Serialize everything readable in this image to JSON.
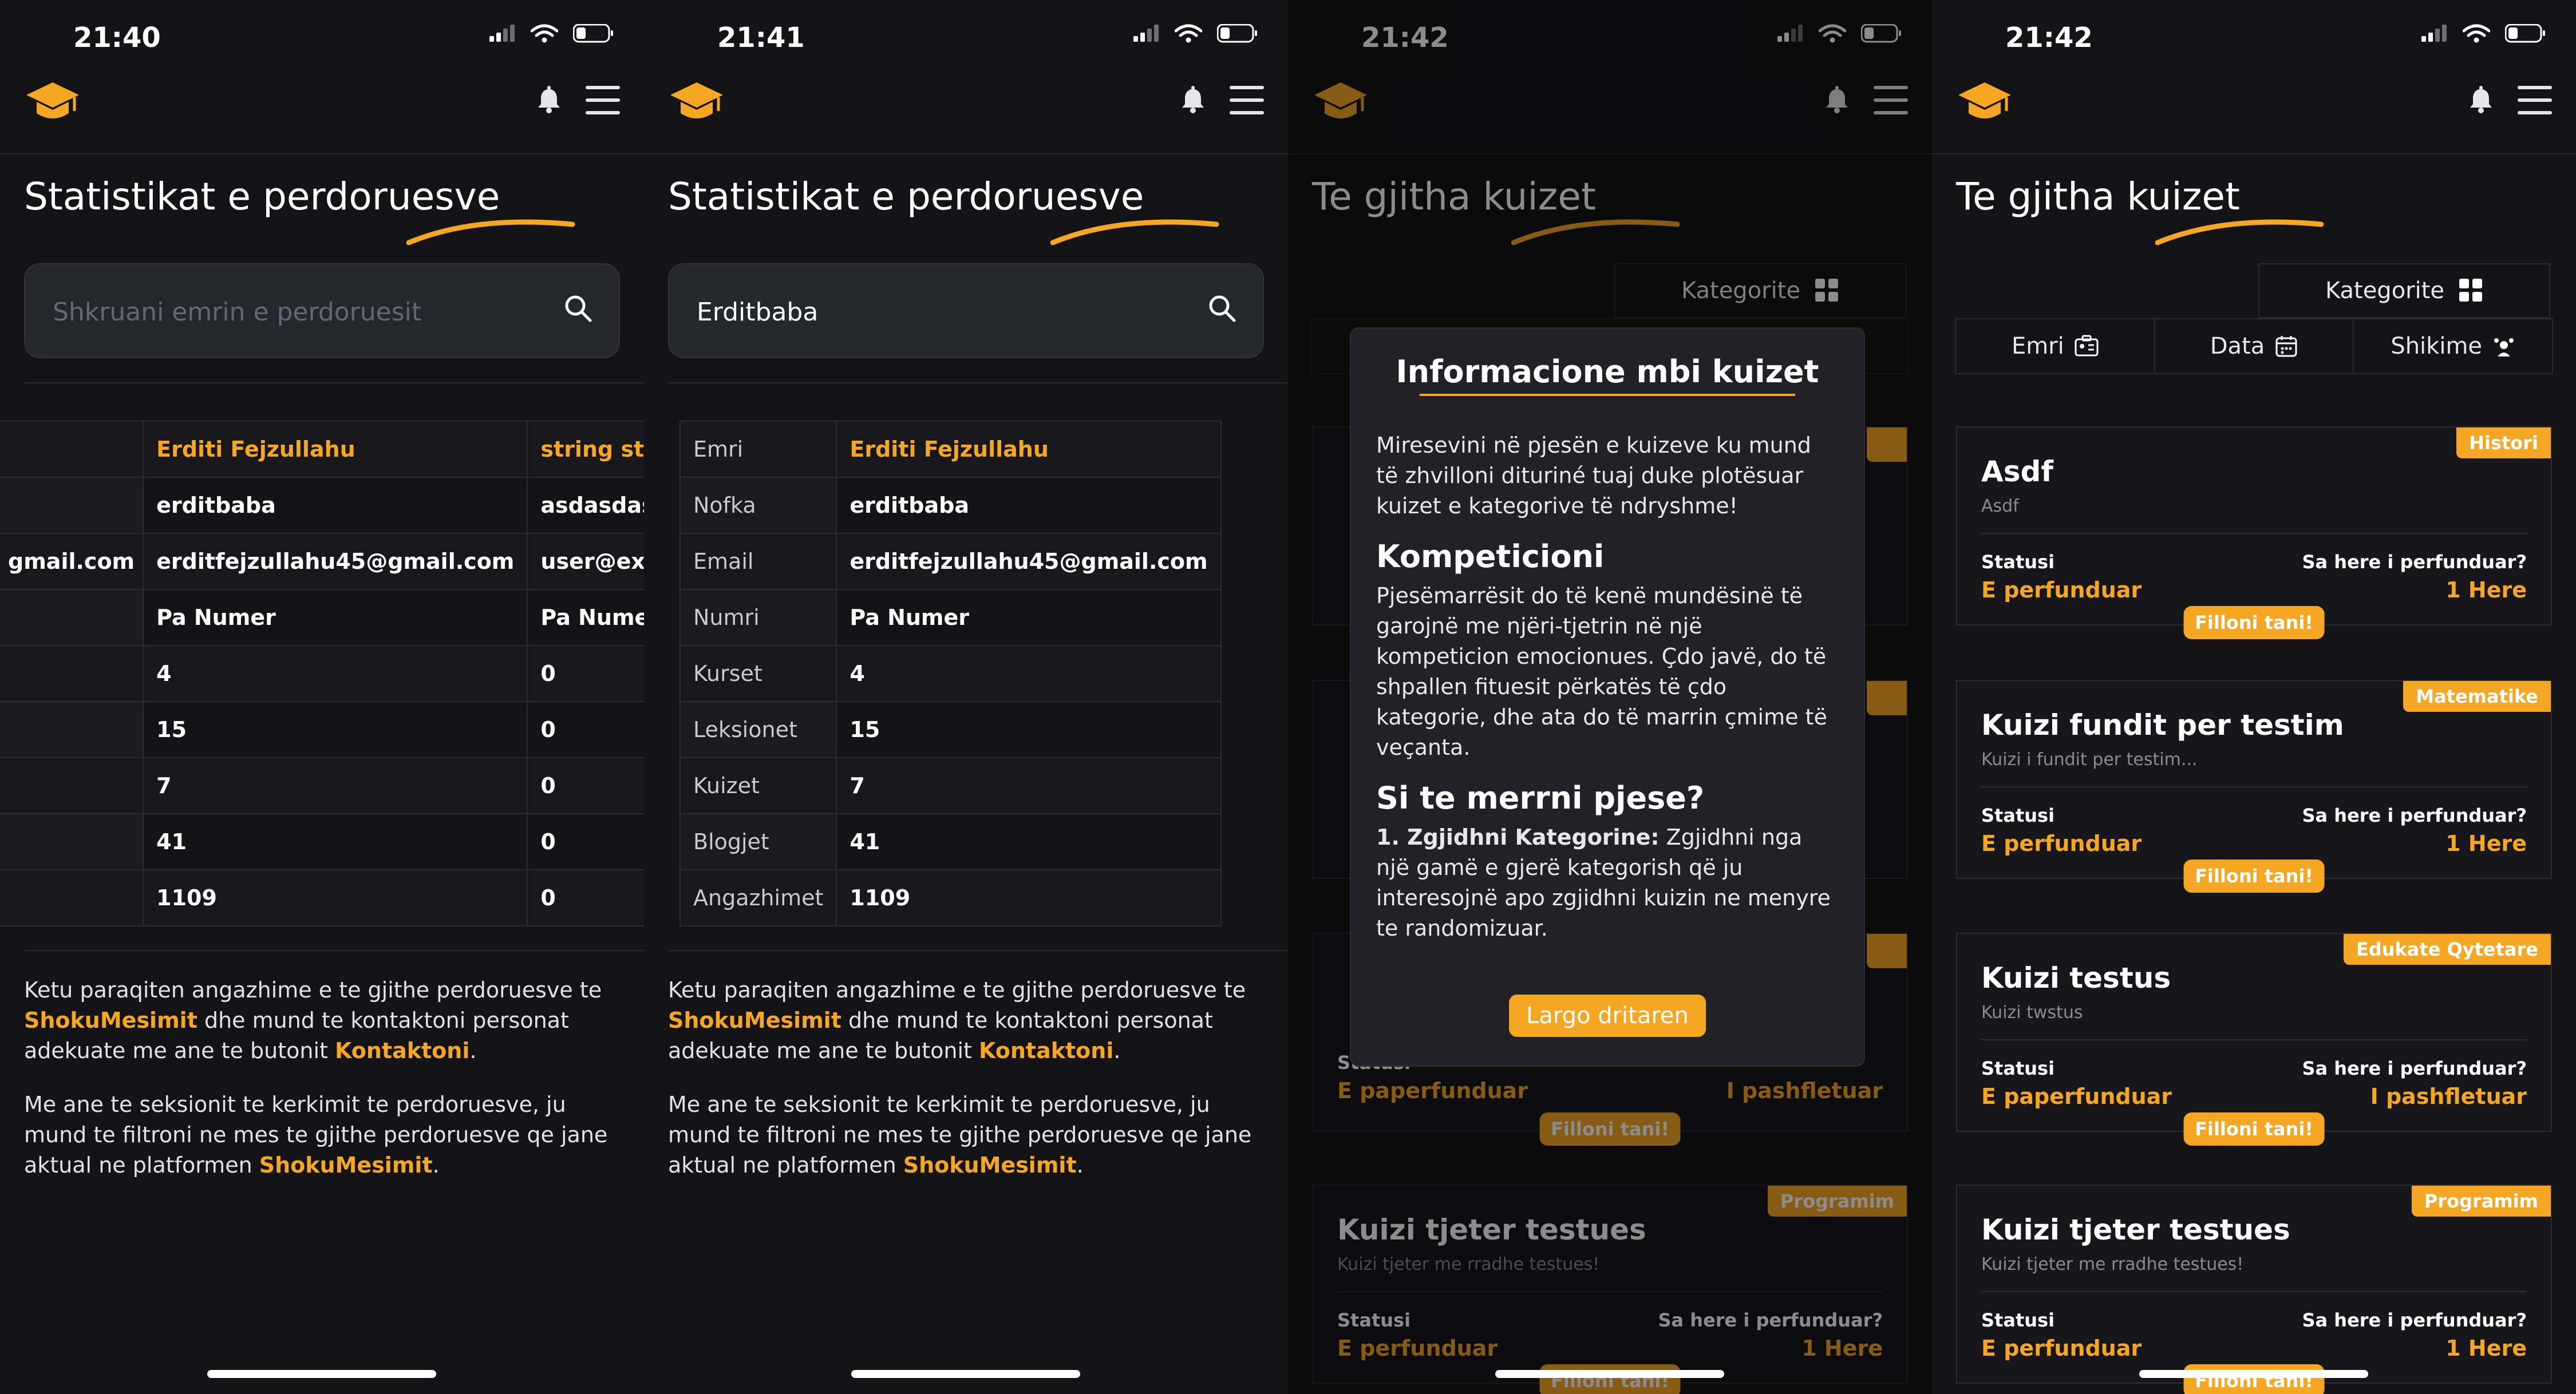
{
  "colors": {
    "accent": "#f5a623",
    "background": "#141417",
    "card": "#17171b",
    "border": "#2c2c33"
  },
  "icons": {
    "logo": "graduation-cap-icon",
    "bell": "bell-icon",
    "menu": "hamburger-menu-icon",
    "search": "search-icon",
    "grid": "grid-icon",
    "id": "id-card-icon",
    "calendar": "calendar-icon",
    "views": "users-icon"
  },
  "screens": [
    {
      "time": "21:40",
      "title": "Statistikat e perdoruesve",
      "search_placeholder": "Shkruani emrin e perdoruesit",
      "table": {
        "rows": [
          [
            "",
            "Erditi Fejzullahu",
            "string strir"
          ],
          [
            "",
            "erditbaba",
            "asdasdas"
          ],
          [
            "gmail.com",
            "erditfejzullahu45@gmail.com",
            "user@exa"
          ],
          [
            "",
            "Pa Numer",
            "Pa Numer"
          ],
          [
            "",
            "4",
            "0"
          ],
          [
            "",
            "15",
            "0"
          ],
          [
            "",
            "7",
            "0"
          ],
          [
            "",
            "41",
            "0"
          ],
          [
            "",
            "1109",
            "0"
          ]
        ]
      },
      "para1": {
        "t1": "Ketu paraqiten angazhime e te gjithe perdoruesve te ",
        "b1": "ShokuMesimit",
        "t2": " dhe mund te kontaktoni personat adekuate me ane te butonit ",
        "b2": "Kontaktoni",
        "t3": "."
      },
      "para2": {
        "t1": "Me ane te seksionit te kerkimit te perdoruesve, ju mund te filtroni ne mes te gjithe perdoruesve qe jane aktual ne platformen ",
        "b1": "ShokuMesimit",
        "t2": "."
      }
    },
    {
      "time": "21:41",
      "title": "Statistikat e perdoruesve",
      "search_value": "Erditbaba",
      "table": {
        "rows": [
          [
            "Emri",
            "Erditi Fejzullahu"
          ],
          [
            "Nofka",
            "erditbaba"
          ],
          [
            "Email",
            "erditfejzullahu45@gmail.com"
          ],
          [
            "Numri",
            "Pa Numer"
          ],
          [
            "Kurset",
            "4"
          ],
          [
            "Leksionet",
            "15"
          ],
          [
            "Kuizet",
            "7"
          ],
          [
            "Blogjet",
            "41"
          ],
          [
            "Angazhimet",
            "1109"
          ]
        ]
      },
      "para1": {
        "t1": "Ketu paraqiten angazhime e te gjithe perdoruesve te ",
        "b1": "ShokuMesimit",
        "t2": " dhe mund te kontaktoni personat adekuate me ane te butonit ",
        "b2": "Kontaktoni",
        "t3": "."
      },
      "para2": {
        "t1": "Me ane te seksionit te kerkimit te perdoruesve, ju mund te filtroni ne mes te gjithe perdoruesve qe jane aktual ne platformen ",
        "b1": "ShokuMesimit",
        "t2": "."
      }
    },
    {
      "time": "21:42",
      "title": "Te gjitha kuizet",
      "categories_label": "Kategorite",
      "modal": {
        "title": "Informacione mbi kuizet",
        "intro": "Miresevini në pjesën e kuizeve ku mund të zhvilloni dituriné tuaj duke plotësuar kuizet e kategorive të ndryshme!",
        "h1": "Kompeticioni",
        "p1": "Pjesëmarrësit do të kenë mundësinë të garojnë me njëri-tjetrin në një kompeticion emocionues. Çdo javë, do të shpallen fituesit përkatës të çdo kategorie, dhe ata do të marrin çmime të veçanta.",
        "h2": "Si te merrni pjese?",
        "step1_bold": "1. Zgjidhni Kategorine:",
        "step1_text": " Zgjidhni nga një gamë e gjerë kategorish që ju interesojnë apo zgjidhni kuizin ne menyre te randomizuar.",
        "button": "Largo dritaren"
      },
      "bottom_card": {
        "badge": "Programim",
        "title": "Kuizi tjeter testues",
        "subtitle": "Kuizi tjeter me rradhe testues!",
        "status_label": "Statusi",
        "status": "E perfunduar",
        "count_label": "Sa here i perfunduar?",
        "count": "1 Here",
        "button": "Filloni tani!"
      },
      "mid_card": {
        "status_label": "Statusi",
        "status": "E paperfunduar",
        "count": "I pashfletuar",
        "button": "Filloni tani!"
      }
    },
    {
      "time": "21:42",
      "title": "Te gjitha kuizet",
      "categories_label": "Kategorite",
      "filters": [
        "Emri",
        "Data",
        "Shikime"
      ],
      "cards": [
        {
          "badge": "Histori",
          "title": "Asdf",
          "subtitle": "Asdf",
          "status_label": "Statusi",
          "status": "E perfunduar",
          "count_label": "Sa here i perfunduar?",
          "count": "1 Here",
          "button": "Filloni tani!"
        },
        {
          "badge": "Matematike",
          "title": "Kuizi fundit per testim",
          "subtitle": "Kuizi i fundit per testim...",
          "status_label": "Statusi",
          "status": "E perfunduar",
          "count_label": "Sa here i perfunduar?",
          "count": "1 Here",
          "button": "Filloni tani!"
        },
        {
          "badge": "Edukate Qytetare",
          "title": "Kuizi testus",
          "subtitle": "Kuizi twstus",
          "status_label": "Statusi",
          "status": "E paperfunduar",
          "count_label": "Sa here i perfunduar?",
          "count": "I pashfletuar",
          "button": "Filloni tani!"
        },
        {
          "badge": "Programim",
          "title": "Kuizi tjeter testues",
          "subtitle": "Kuizi tjeter me rradhe testues!",
          "status_label": "Statusi",
          "status": "E perfunduar",
          "count_label": "Sa here i perfunduar?",
          "count": "1 Here",
          "button": "Filloni tani!"
        }
      ]
    }
  ]
}
